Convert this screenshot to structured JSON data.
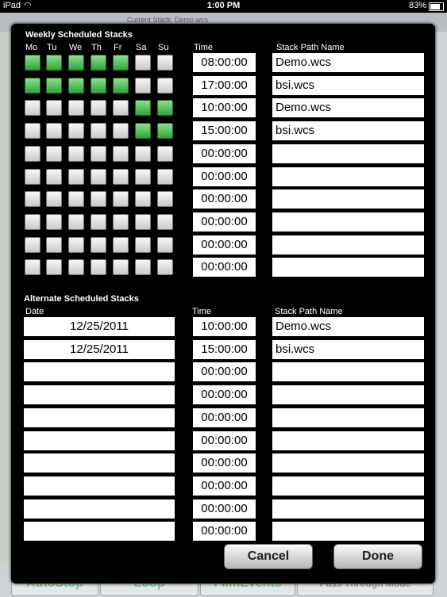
{
  "status_bar": {
    "carrier": "iPad",
    "wifi_icon": "wifi-icon",
    "time": "1:00 PM",
    "battery": "83%"
  },
  "background": {
    "current_stack": "Current Stack: Demo.wcs",
    "bottom_buttons": [
      "AutoStop",
      "Loop",
      "FilmEvents",
      "Pass Through Mode"
    ]
  },
  "weekly": {
    "title": "Weekly Scheduled Stacks",
    "days": [
      "Mo",
      "Tu",
      "We",
      "Th",
      "Fr",
      "Sa",
      "Su"
    ],
    "time_header": "Time",
    "path_header": "Stack Path Name",
    "rows": [
      {
        "days": [
          true,
          true,
          true,
          true,
          true,
          false,
          false
        ],
        "time": "08:00:00",
        "path": "Demo.wcs"
      },
      {
        "days": [
          true,
          true,
          true,
          true,
          true,
          false,
          false
        ],
        "time": "17:00:00",
        "path": "bsi.wcs"
      },
      {
        "days": [
          false,
          false,
          false,
          false,
          false,
          true,
          true
        ],
        "time": "10:00:00",
        "path": "Demo.wcs"
      },
      {
        "days": [
          false,
          false,
          false,
          false,
          false,
          true,
          true
        ],
        "time": "15:00:00",
        "path": "bsi.wcs"
      },
      {
        "days": [
          false,
          false,
          false,
          false,
          false,
          false,
          false
        ],
        "time": "00:00:00",
        "path": ""
      },
      {
        "days": [
          false,
          false,
          false,
          false,
          false,
          false,
          false
        ],
        "time": "00:00:00",
        "path": ""
      },
      {
        "days": [
          false,
          false,
          false,
          false,
          false,
          false,
          false
        ],
        "time": "00:00:00",
        "path": ""
      },
      {
        "days": [
          false,
          false,
          false,
          false,
          false,
          false,
          false
        ],
        "time": "00:00:00",
        "path": ""
      },
      {
        "days": [
          false,
          false,
          false,
          false,
          false,
          false,
          false
        ],
        "time": "00:00:00",
        "path": ""
      },
      {
        "days": [
          false,
          false,
          false,
          false,
          false,
          false,
          false
        ],
        "time": "00:00:00",
        "path": ""
      }
    ]
  },
  "alternate": {
    "title": "Alternate Scheduled Stacks",
    "date_header": "Date",
    "time_header": "Time",
    "path_header": "Stack Path Name",
    "rows": [
      {
        "date": "12/25/2011",
        "time": "10:00:00",
        "path": "Demo.wcs"
      },
      {
        "date": "12/25/2011",
        "time": "15:00:00",
        "path": "bsi.wcs"
      },
      {
        "date": "",
        "time": "00:00:00",
        "path": ""
      },
      {
        "date": "",
        "time": "00:00:00",
        "path": ""
      },
      {
        "date": "",
        "time": "00:00:00",
        "path": ""
      },
      {
        "date": "",
        "time": "00:00:00",
        "path": ""
      },
      {
        "date": "",
        "time": "00:00:00",
        "path": ""
      },
      {
        "date": "",
        "time": "00:00:00",
        "path": ""
      },
      {
        "date": "",
        "time": "00:00:00",
        "path": ""
      },
      {
        "date": "",
        "time": "00:00:00",
        "path": ""
      }
    ]
  },
  "buttons": {
    "cancel": "Cancel",
    "done": "Done"
  }
}
